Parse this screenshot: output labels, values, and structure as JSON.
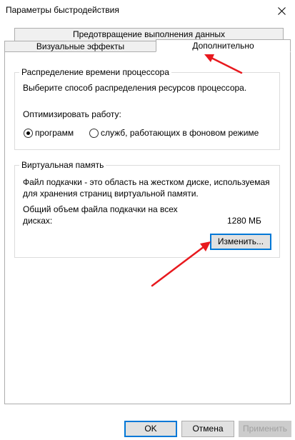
{
  "window": {
    "title": "Параметры быстродействия",
    "close_icon": "close-icon"
  },
  "tabs": {
    "dep": "Предотвращение выполнения данных",
    "visual": "Визуальные эффекты",
    "advanced": "Дополнительно"
  },
  "cpu": {
    "legend": "Распределение времени процессора",
    "description": "Выберите способ распределения ресурсов процессора.",
    "optimize_label": "Оптимизировать работу:",
    "option_programs": "программ",
    "option_services": "служб, работающих в фоновом режиме",
    "selected": "программ"
  },
  "vm": {
    "legend": "Виртуальная память",
    "description_line1": "Файл подкачки - это область на жестком диске, используемая",
    "description_line2": "для хранения страниц виртуальной памяти.",
    "total_label_line1": "Общий объем файла подкачки на всех",
    "total_label_line2": "дисках:",
    "total_value": "1280 МБ",
    "change_button": "Изменить..."
  },
  "buttons": {
    "ok": "OK",
    "cancel": "Отмена",
    "apply": "Применить"
  },
  "annotation_color": "#e8191e"
}
